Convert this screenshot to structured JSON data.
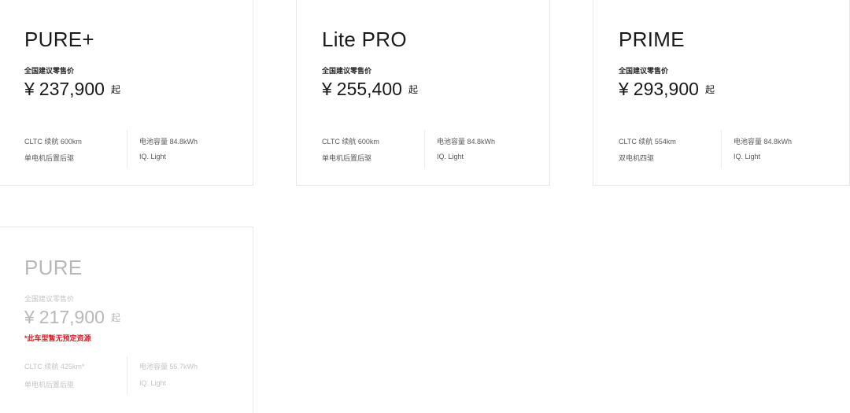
{
  "cards": [
    {
      "name": "PURE+",
      "price_label": "全国建议零售价",
      "currency": "¥",
      "price": "237,900",
      "suffix": "起",
      "specs": [
        "CLTC 续航 600km",
        "单电机后置后驱",
        "电池容量 84.8kWh",
        "IQ. Light"
      ]
    },
    {
      "name": "Lite PRO",
      "price_label": "全国建议零售价",
      "currency": "¥",
      "price": "255,400",
      "suffix": "起",
      "specs": [
        "CLTC 续航 600km",
        "单电机后置后驱",
        "电池容量 84.8kWh",
        "IQ. Light"
      ]
    },
    {
      "name": "PRIME",
      "price_label": "全国建议零售价",
      "currency": "¥",
      "price": "293,900",
      "suffix": "起",
      "specs": [
        "CLTC 续航 554km",
        "双电机四驱",
        "电池容量 84.8kWh",
        "IQ. Light"
      ]
    },
    {
      "name": "PURE",
      "price_label": "全国建议零售价",
      "currency": "¥",
      "price": "217,900",
      "suffix": "起",
      "notice": "*此车型暂无预定资源",
      "specs": [
        "CLTC 续航 425km*",
        "单电机后置后驱",
        "电池容量 55.7kWh",
        "IQ. Light"
      ]
    }
  ],
  "colors": {
    "text": "#1a1a1a",
    "muted": "#b8b8b8",
    "notice": "#d0212a",
    "border": "#e6e6e6"
  }
}
